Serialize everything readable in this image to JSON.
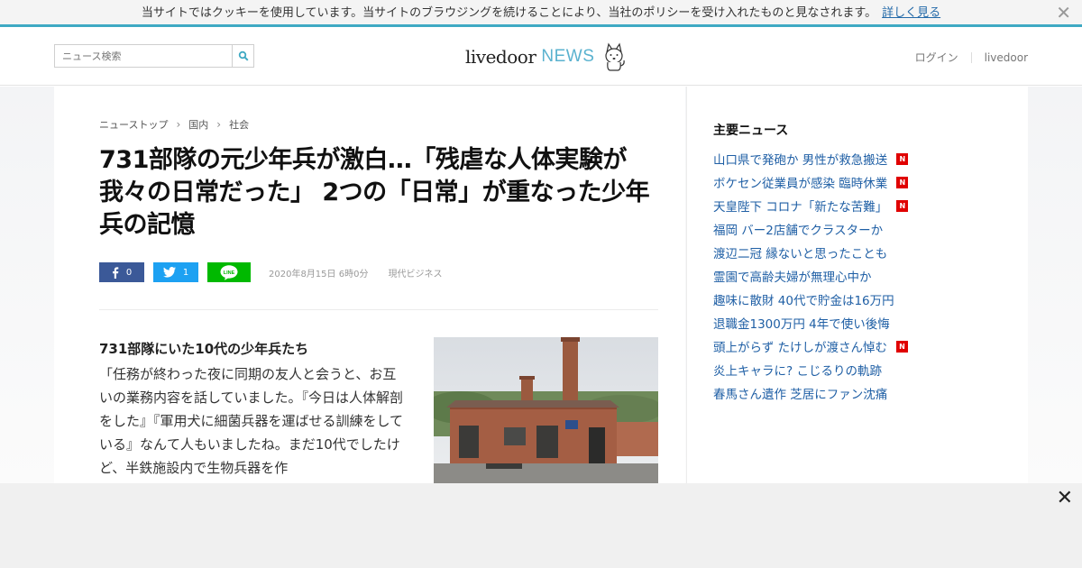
{
  "cookie": {
    "text": "当サイトではクッキーを使用しています。当サイトのブラウジングを続けることにより、当社のポリシーを受け入れたものと見なされます。",
    "link": "詳しく見る"
  },
  "header": {
    "search_placeholder": "ニュース検索",
    "logo_main": "livedoor",
    "logo_sub": "NEWS",
    "nav": [
      "ログイン",
      "livedoor"
    ]
  },
  "breadcrumb": [
    "ニューストップ",
    "国内",
    "社会"
  ],
  "article": {
    "title": "731部隊の元少年兵が激白…「残虐な人体実験が我々の日常だった」 2つの「日常」が重なった少年兵の記憶",
    "share": {
      "facebook_count": "0",
      "twitter_count": "1",
      "line_label": "LINE"
    },
    "date": "2020年8月15日 6時0分",
    "source": "現代ビジネス",
    "lead": "731部隊にいた10代の少年兵たち",
    "body": "「任務が終わった夜に同期の友人と会うと、お互いの業務内容を話していました。『今日は人体解剖をした』『軍用犬に細菌兵器を運ばせる訓練をしている』なんて人もいましたね。まだ10代でしたけど、半鉄施設内で生物兵器を作"
  },
  "sidebar": {
    "title": "主要ニュース",
    "items": [
      {
        "label": "山口県で発砲か 男性が救急搬送",
        "badge": "N"
      },
      {
        "label": "ボケセン従業員が感染 臨時休業",
        "badge": "N"
      },
      {
        "label": "天皇陛下 コロナ「新たな苦難」",
        "badge": "N"
      },
      {
        "label": "福岡 バー2店舗でクラスターか",
        "badge": ""
      },
      {
        "label": "渡辺二冠 縁ないと思ったことも",
        "badge": ""
      },
      {
        "label": "霊園で高齢夫婦が無理心中か",
        "badge": ""
      },
      {
        "label": "趣味に散財 40代で貯金は16万円",
        "badge": ""
      },
      {
        "label": "退職金1300万円 4年で使い後悔",
        "badge": ""
      },
      {
        "label": "頭上がらず たけしが渡さん悼む",
        "badge": "N"
      },
      {
        "label": "炎上キャラに? こじるりの軌跡",
        "badge": ""
      },
      {
        "label": "春馬さん遺作 芝居にファン沈痛",
        "badge": ""
      }
    ]
  },
  "colors": {
    "accent": "#3fa9c3",
    "link": "#1f5fa5",
    "badge": "#e00000",
    "facebook": "#3b5998",
    "twitter": "#1da1f2",
    "line": "#00b900"
  }
}
